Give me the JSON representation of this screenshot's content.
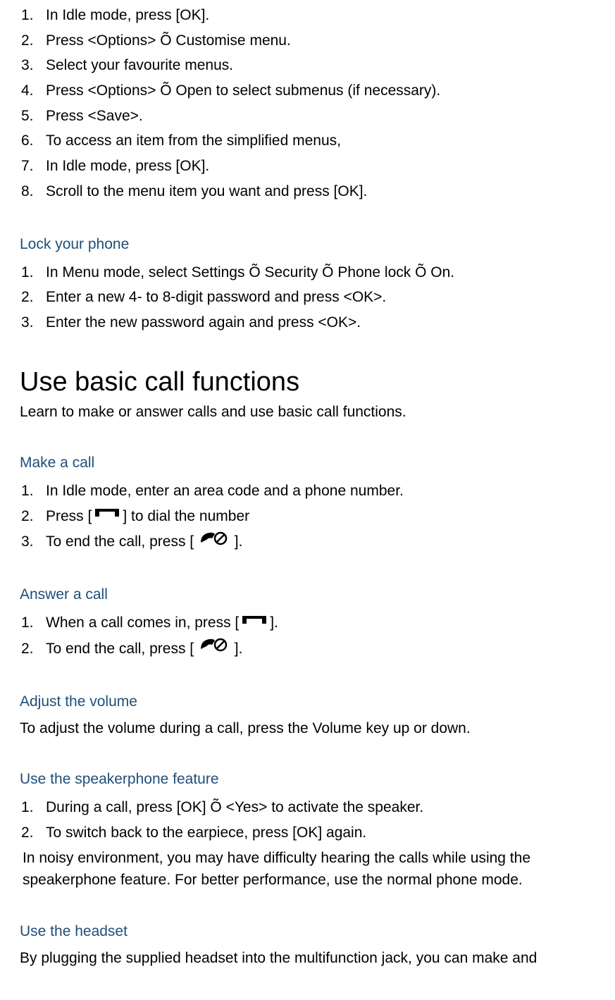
{
  "list1": {
    "items": [
      {
        "num": "1.",
        "text": "In Idle mode, press [OK]."
      },
      {
        "num": "2.",
        "text": "Press <Options> Õ Customise menu."
      },
      {
        "num": "3.",
        "text": "Select your favourite menus."
      },
      {
        "num": "4.",
        "text": "Press <Options> Õ Open to select submenus (if necessary)."
      },
      {
        "num": "5.",
        "text": "Press <Save>."
      },
      {
        "num": "6.",
        "text": "To access an item from the simplified menus,"
      },
      {
        "num": "7.",
        "text": "In Idle mode, press [OK]."
      },
      {
        "num": "8.",
        "text": "Scroll to the menu item you want and press [OK]."
      }
    ]
  },
  "lock": {
    "heading": "Lock your phone",
    "items": [
      {
        "num": "1.",
        "text": "In Menu mode, select Settings Õ Security Õ Phone lock Õ On."
      },
      {
        "num": "2.",
        "text": "Enter a new 4- to 8-digit password and press <OK>."
      },
      {
        "num": "3.",
        "text": "Enter the new password again and press <OK>."
      }
    ]
  },
  "usebasic": {
    "heading": "Use basic call functions",
    "subtext": "Learn to make or answer calls and use basic call functions."
  },
  "makecall": {
    "heading": "Make a call",
    "items": [
      {
        "num": "1.",
        "text": "In Idle mode, enter an area code and a phone number."
      },
      {
        "num": "2.",
        "pre": "Press [",
        "post": "] to dial the number",
        "icon": "call"
      },
      {
        "num": "3.",
        "pre": "To end the call, press [ ",
        "post": " ].",
        "icon": "hangup"
      }
    ]
  },
  "answercall": {
    "heading": "Answer a call",
    "items": [
      {
        "num": "1.",
        "pre": "When a call comes in, press [",
        "post": "].",
        "icon": "call"
      },
      {
        "num": "2.",
        "pre": "To end the call, press [ ",
        "post": " ].",
        "icon": "hangup"
      }
    ]
  },
  "adjustvol": {
    "heading": "Adjust the volume",
    "text": "To adjust the volume during a call, press the Volume key up or down."
  },
  "speaker": {
    "heading": "Use the speakerphone feature",
    "items": [
      {
        "num": "1.",
        "text": "During a call, press [OK] Õ <Yes> to activate the speaker."
      },
      {
        "num": "2.",
        "text": "To switch back to the earpiece, press [OK] again."
      }
    ],
    "note": "In noisy environment, you may have difficulty hearing the calls while using the speakerphone feature. For better performance, use the normal phone mode."
  },
  "headset": {
    "heading": "Use the headset",
    "text": "By plugging the supplied headset into the multifunction jack, you can make and"
  }
}
